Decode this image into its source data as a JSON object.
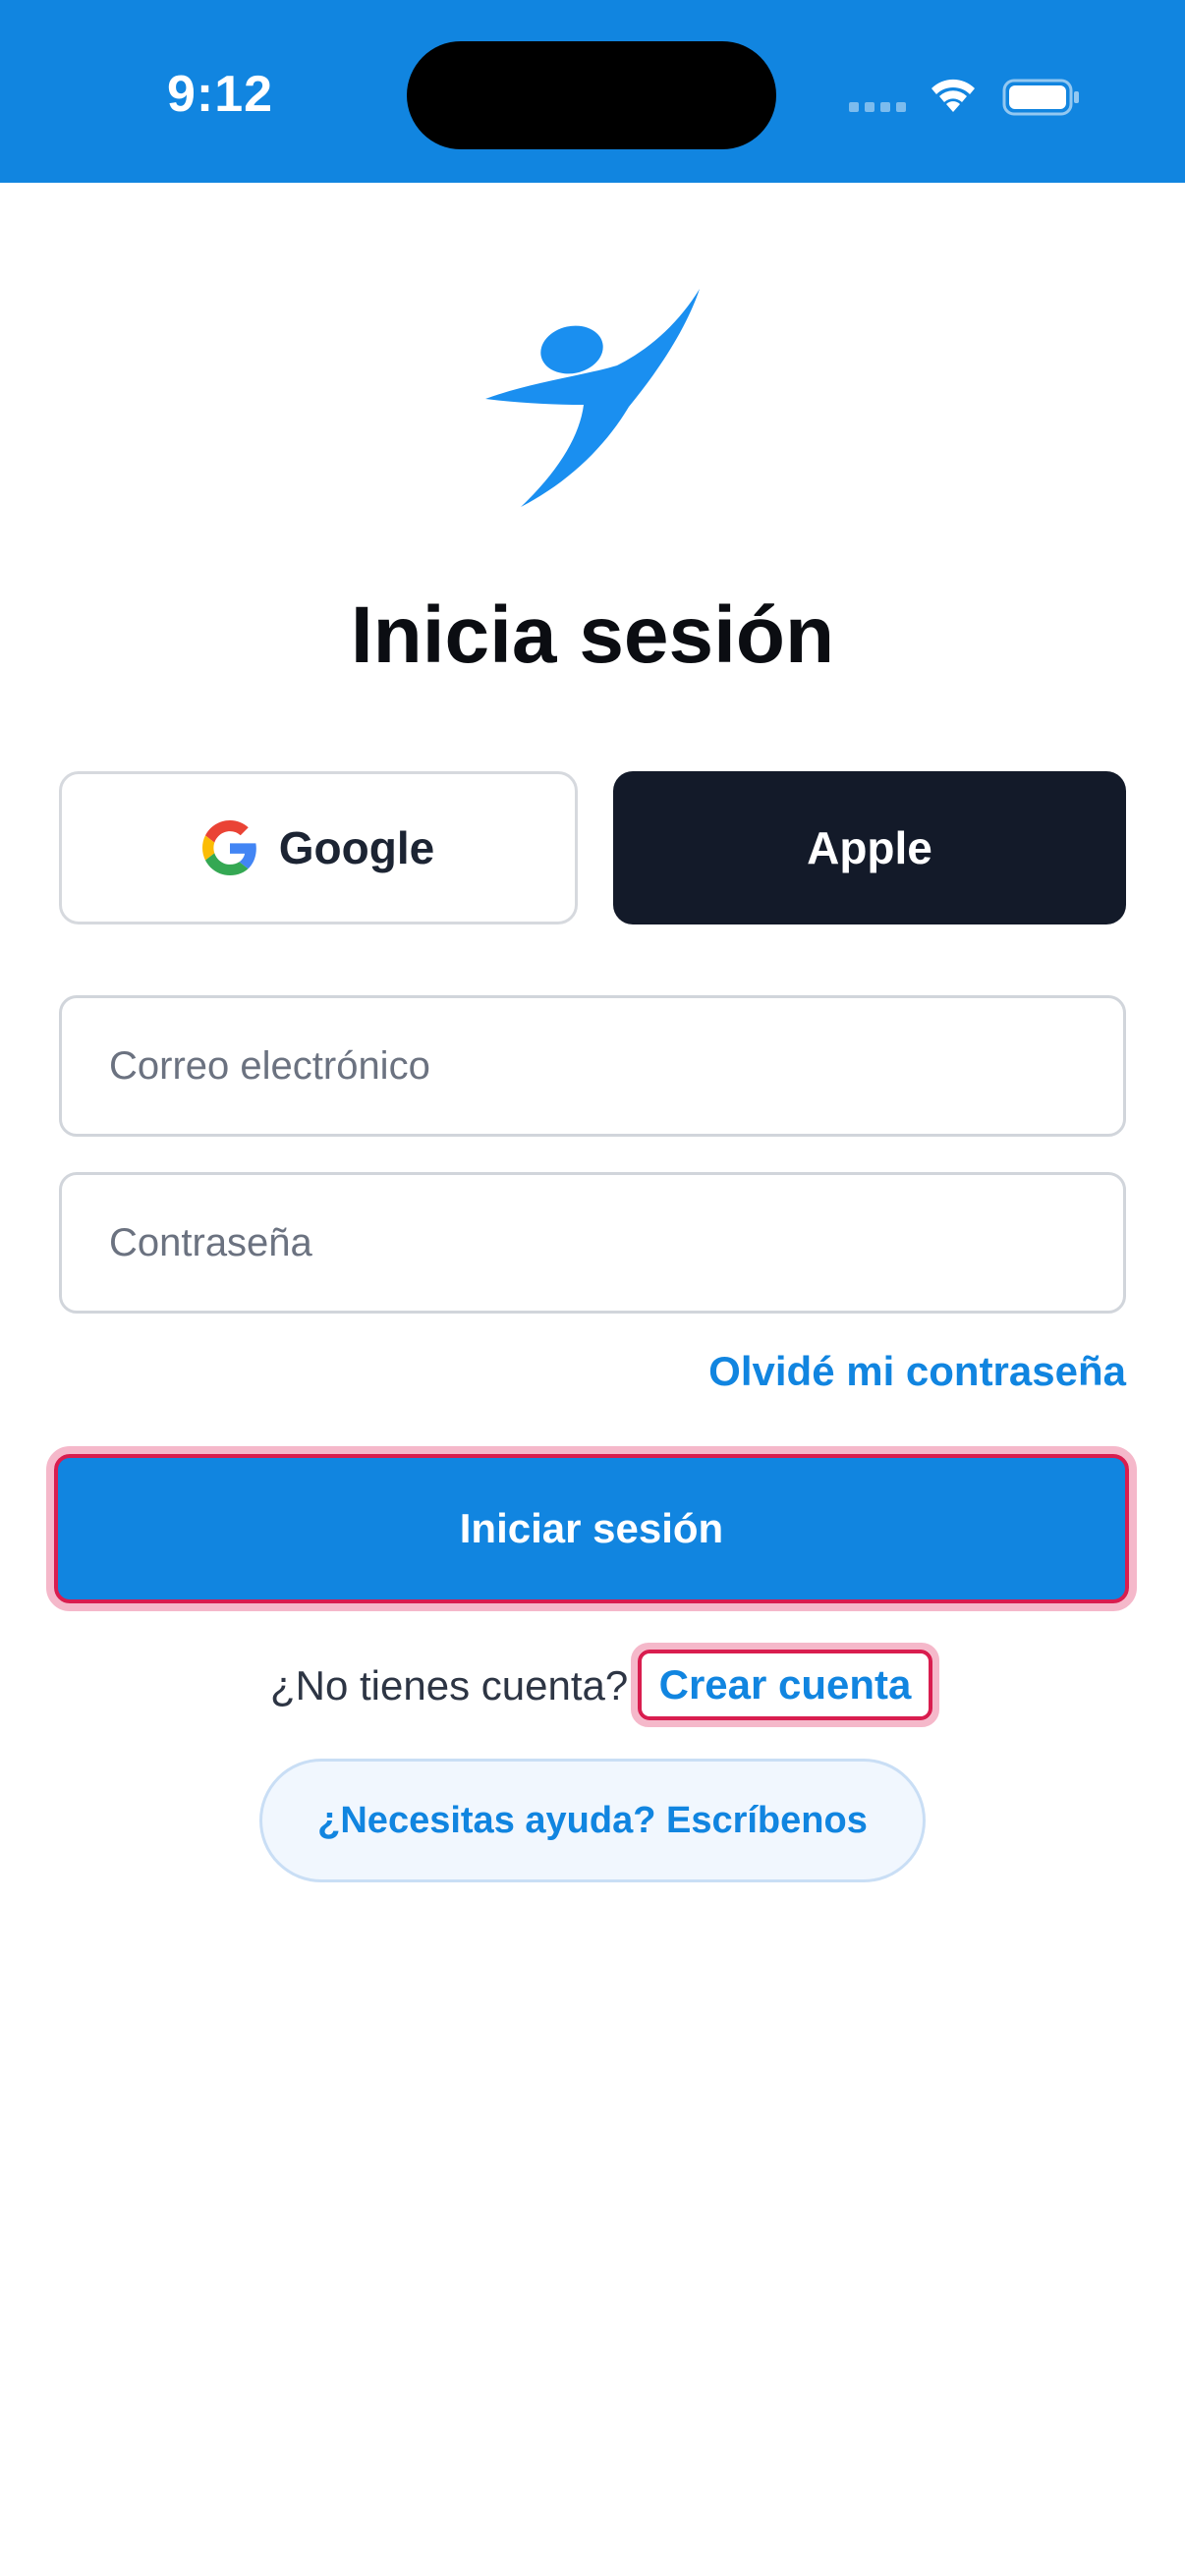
{
  "status_bar": {
    "time": "9:12",
    "background": "#1185e0"
  },
  "logo": {
    "icon": "person-leaping-icon",
    "color": "#1a8ff0"
  },
  "title": "Inicia sesión",
  "social": {
    "google_label": "Google",
    "apple_label": "Apple"
  },
  "form": {
    "email_placeholder": "Correo electrónico",
    "email_value": "",
    "password_placeholder": "Contraseña",
    "password_value": "",
    "forgot_label": "Olvidé mi contraseña",
    "submit_label": "Iniciar sesión"
  },
  "signup": {
    "prompt": "¿No tienes cuenta?",
    "link": "Crear cuenta"
  },
  "help": {
    "label": "¿Necesitas ayuda? Escríbenos"
  },
  "colors": {
    "accent": "#1185e0",
    "dark": "#131a29",
    "highlight": "#d91d4f"
  }
}
